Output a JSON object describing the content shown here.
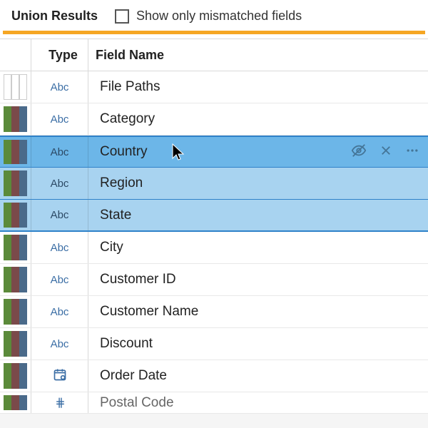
{
  "header": {
    "title": "Union Results",
    "checkbox_label": "Show only mismatched fields",
    "checkbox_checked": false
  },
  "columns": {
    "type": "Type",
    "field_name": "Field Name"
  },
  "colors": {
    "accent": "#f5a623",
    "stripe1": "#5b8a3a",
    "stripe2": "#7a4a4a",
    "stripe3": "#4a6a8a",
    "selection_primary": "#6cb6e8",
    "selection_secondary": "#a8d3f0",
    "selection_border": "#2f82c9"
  },
  "type_labels": {
    "abc": "Abc",
    "date": "date-icon",
    "number": "number-icon"
  },
  "row_icons": {
    "hide": "hide-icon",
    "remove": "close-icon",
    "more": "more-icon"
  },
  "rows": [
    {
      "type": "abc",
      "field": "File Paths",
      "stripes": [
        "none",
        "none",
        "none"
      ],
      "selected": null
    },
    {
      "type": "abc",
      "field": "Category",
      "stripes": [
        "s1",
        "s2",
        "s3"
      ],
      "selected": null
    },
    {
      "type": "abc",
      "field": "Country",
      "stripes": [
        "s1",
        "s2",
        "s3"
      ],
      "selected": "primary"
    },
    {
      "type": "abc",
      "field": "Region",
      "stripes": [
        "s1",
        "s2",
        "s3"
      ],
      "selected": "secondary"
    },
    {
      "type": "abc",
      "field": "State",
      "stripes": [
        "s1",
        "s2",
        "s3"
      ],
      "selected": "secondary-last"
    },
    {
      "type": "abc",
      "field": "City",
      "stripes": [
        "s1",
        "s2",
        "s3"
      ],
      "selected": null
    },
    {
      "type": "abc",
      "field": "Customer ID",
      "stripes": [
        "s1",
        "s2",
        "s3"
      ],
      "selected": null
    },
    {
      "type": "abc",
      "field": "Customer Name",
      "stripes": [
        "s1",
        "s2",
        "s3"
      ],
      "selected": null
    },
    {
      "type": "abc",
      "field": "Discount",
      "stripes": [
        "s1",
        "s2",
        "s3"
      ],
      "selected": null
    },
    {
      "type": "date",
      "field": "Order Date",
      "stripes": [
        "s1",
        "s2",
        "s3"
      ],
      "selected": null
    },
    {
      "type": "number",
      "field": "Postal Code",
      "stripes": [
        "s1",
        "s2",
        "s3"
      ],
      "selected": null
    }
  ]
}
